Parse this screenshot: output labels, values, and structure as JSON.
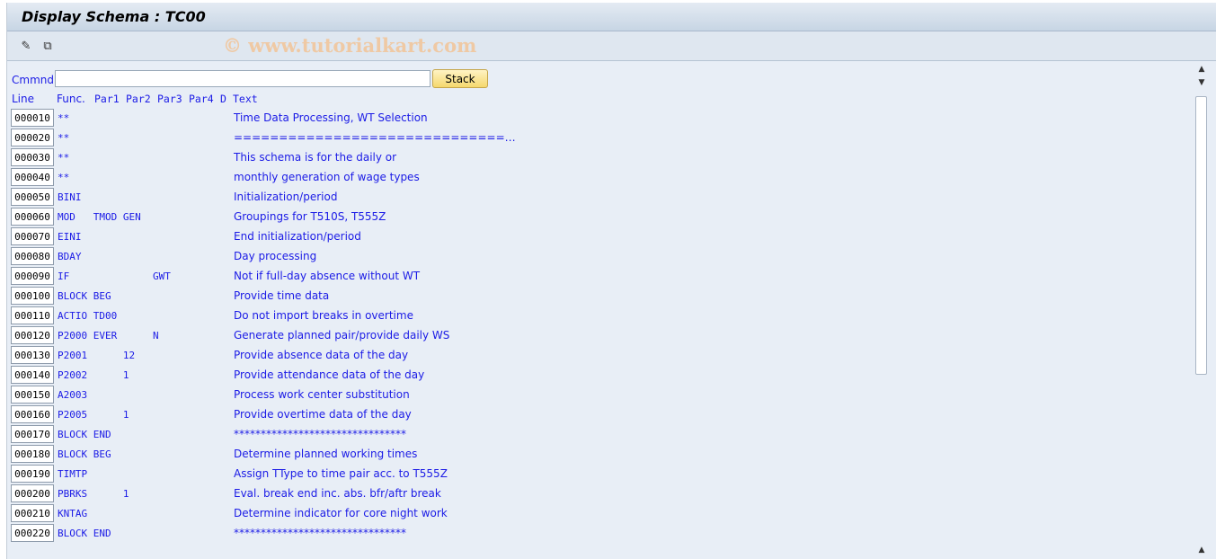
{
  "title": "Display Schema : TC00",
  "toolbar": {
    "icons": [
      "edit-icon",
      "display-change-icon"
    ],
    "watermark": "© www.tutorialkart.com"
  },
  "command": {
    "label": "Cmmnd",
    "value": "",
    "stack_label": "Stack"
  },
  "headers": {
    "line": "Line",
    "func": "Func.",
    "par1": "Par1",
    "par2": "Par2",
    "par3": "Par3",
    "par4": "Par4",
    "d": "D",
    "text": "Text"
  },
  "rows": [
    {
      "line": "000010",
      "code": "**",
      "text": "Time Data Processing, WT Selection"
    },
    {
      "line": "000020",
      "code": "**",
      "text": "==============================…"
    },
    {
      "line": "000030",
      "code": "**",
      "text": "This schema is for the daily or"
    },
    {
      "line": "000040",
      "code": "**",
      "text": "monthly generation of wage types"
    },
    {
      "line": "000050",
      "code": "BINI",
      "text": "Initialization/period"
    },
    {
      "line": "000060",
      "code": "MOD   TMOD GEN",
      "text": "Groupings for T510S, T555Z"
    },
    {
      "line": "000070",
      "code": "EINI",
      "text": "End initialization/period"
    },
    {
      "line": "000080",
      "code": "BDAY",
      "text": "Day processing"
    },
    {
      "line": "000090",
      "code": "IF              GWT",
      "text": "Not if full-day absence without WT"
    },
    {
      "line": "000100",
      "code": "BLOCK BEG",
      "text": "Provide time data"
    },
    {
      "line": "000110",
      "code": "ACTIO TD00",
      "text": "Do not import breaks in overtime"
    },
    {
      "line": "000120",
      "code": "P2000 EVER      N",
      "text": "Generate planned pair/provide daily WS"
    },
    {
      "line": "000130",
      "code": "P2001      12",
      "text": "Provide absence data of the day"
    },
    {
      "line": "000140",
      "code": "P2002      1",
      "text": "Provide attendance data of the day"
    },
    {
      "line": "000150",
      "code": "A2003",
      "text": "Process work center substitution"
    },
    {
      "line": "000160",
      "code": "P2005      1",
      "text": "Provide overtime data of the day"
    },
    {
      "line": "000170",
      "code": "BLOCK END",
      "text": "********************************"
    },
    {
      "line": "000180",
      "code": "BLOCK BEG",
      "text": "Determine planned working times"
    },
    {
      "line": "000190",
      "code": "TIMTP",
      "text": "Assign TType to time pair acc. to T555Z"
    },
    {
      "line": "000200",
      "code": "PBRKS      1",
      "text": "Eval. break end inc. abs. bfr/aftr break"
    },
    {
      "line": "000210",
      "code": "KNTAG",
      "text": "Determine indicator for core night work"
    },
    {
      "line": "000220",
      "code": "BLOCK END",
      "text": "********************************"
    }
  ]
}
